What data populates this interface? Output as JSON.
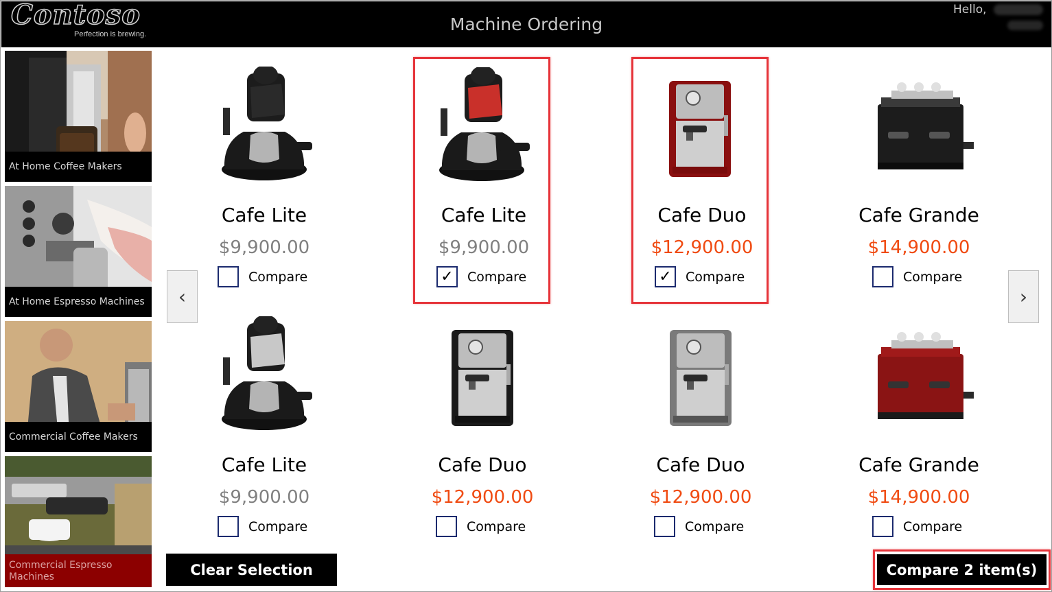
{
  "header": {
    "logo_text": "Contoso",
    "logo_tagline": "Perfection is brewing.",
    "title": "Machine Ordering",
    "greeting": "Hello,"
  },
  "sidebar": {
    "items": [
      {
        "label": "At Home Coffee Makers",
        "selected": false
      },
      {
        "label": "At Home Espresso Machines",
        "selected": false
      },
      {
        "label": "Commercial Coffee Makers",
        "selected": false
      },
      {
        "label": "Commercial Espresso Machines",
        "selected": true
      }
    ]
  },
  "nav": {
    "prev_icon": "chevron-left-icon",
    "next_icon": "chevron-right-icon",
    "prev_glyph": "‹",
    "next_glyph": "›"
  },
  "products": [
    {
      "name": "Cafe Lite",
      "price": "$9,900.00",
      "price_color": "gray",
      "compare_label": "Compare",
      "checked": false,
      "highlighted": false,
      "image": "espresso-pot-black-icon"
    },
    {
      "name": "Cafe Lite",
      "price": "$9,900.00",
      "price_color": "gray",
      "compare_label": "Compare",
      "checked": true,
      "highlighted": true,
      "image": "espresso-pot-red-icon"
    },
    {
      "name": "Cafe Duo",
      "price": "$12,900.00",
      "price_color": "red",
      "compare_label": "Compare",
      "checked": true,
      "highlighted": true,
      "image": "espresso-machine-red-icon"
    },
    {
      "name": "Cafe Grande",
      "price": "$14,900.00",
      "price_color": "red",
      "compare_label": "Compare",
      "checked": false,
      "highlighted": false,
      "image": "commercial-espresso-black-icon"
    },
    {
      "name": "Cafe Lite",
      "price": "$9,900.00",
      "price_color": "gray",
      "compare_label": "Compare",
      "checked": false,
      "highlighted": false,
      "image": "espresso-pot-silver-icon"
    },
    {
      "name": "Cafe Duo",
      "price": "$12,900.00",
      "price_color": "red",
      "compare_label": "Compare",
      "checked": false,
      "highlighted": false,
      "image": "espresso-machine-black-icon"
    },
    {
      "name": "Cafe Duo",
      "price": "$12,900.00",
      "price_color": "red",
      "compare_label": "Compare",
      "checked": false,
      "highlighted": false,
      "image": "espresso-machine-silver-icon"
    },
    {
      "name": "Cafe Grande",
      "price": "$14,900.00",
      "price_color": "red",
      "compare_label": "Compare",
      "checked": false,
      "highlighted": false,
      "image": "commercial-espresso-red-icon"
    }
  ],
  "buttons": {
    "clear_label": "Clear Selection",
    "compare_label": "Compare 2 item(s)"
  },
  "colors": {
    "price_red": "#f04b12",
    "price_gray": "#808080",
    "highlight_border": "#e6343a",
    "checkbox_border": "#1b2a6e",
    "selected_category": "#8c0000"
  }
}
